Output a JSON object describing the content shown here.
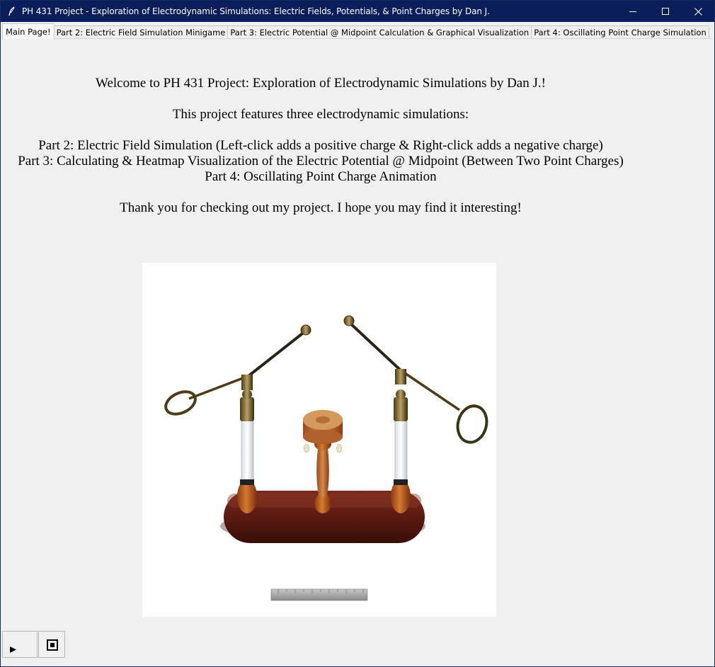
{
  "window": {
    "title": "PH 431 Project - Exploration of Electrodynamic Simulations: Electric Fields, Potentials, & Point Charges by Dan J.",
    "app_icon": "feather-icon",
    "controls": [
      "minimize-icon",
      "maximize-icon",
      "close-icon"
    ]
  },
  "tabs": [
    {
      "label": "Main Page!",
      "active": true
    },
    {
      "label": "Part 2: Electric Field Simulation Minigame",
      "active": false
    },
    {
      "label": "Part 3: Electric Potential @ Midpoint Calculation & Graphical Visualization",
      "active": false
    },
    {
      "label": "Part 4: Oscillating Point Charge Simulation",
      "active": false
    }
  ],
  "intro": {
    "welcome": "Welcome to PH 431 Project: Exploration of Electrodynamic Simulations by Dan J.!",
    "features_heading": "This project features three electrodynamic simulations:",
    "part2": "Part 2: Electric Field Simulation (Left-click adds a positive charge & Right-click adds a negative charge)",
    "part3": "Part 3: Calculating & Heatmap Visualization of the Electric Potential @ Midpoint (Between Two Point Charges)",
    "part4": "Part 4: Oscillating Point Charge Animation",
    "thanks": "Thank you for checking out my project. I hope you may find it interesting!"
  },
  "media_controls": {
    "play_icon": "play-icon",
    "stop_icon": "stop-icon"
  },
  "colors": {
    "titlebar": "#0a1e5c",
    "background": "#f0f0f0",
    "wood_dark": "#5a1a12",
    "brass": "#6b5a2a"
  }
}
